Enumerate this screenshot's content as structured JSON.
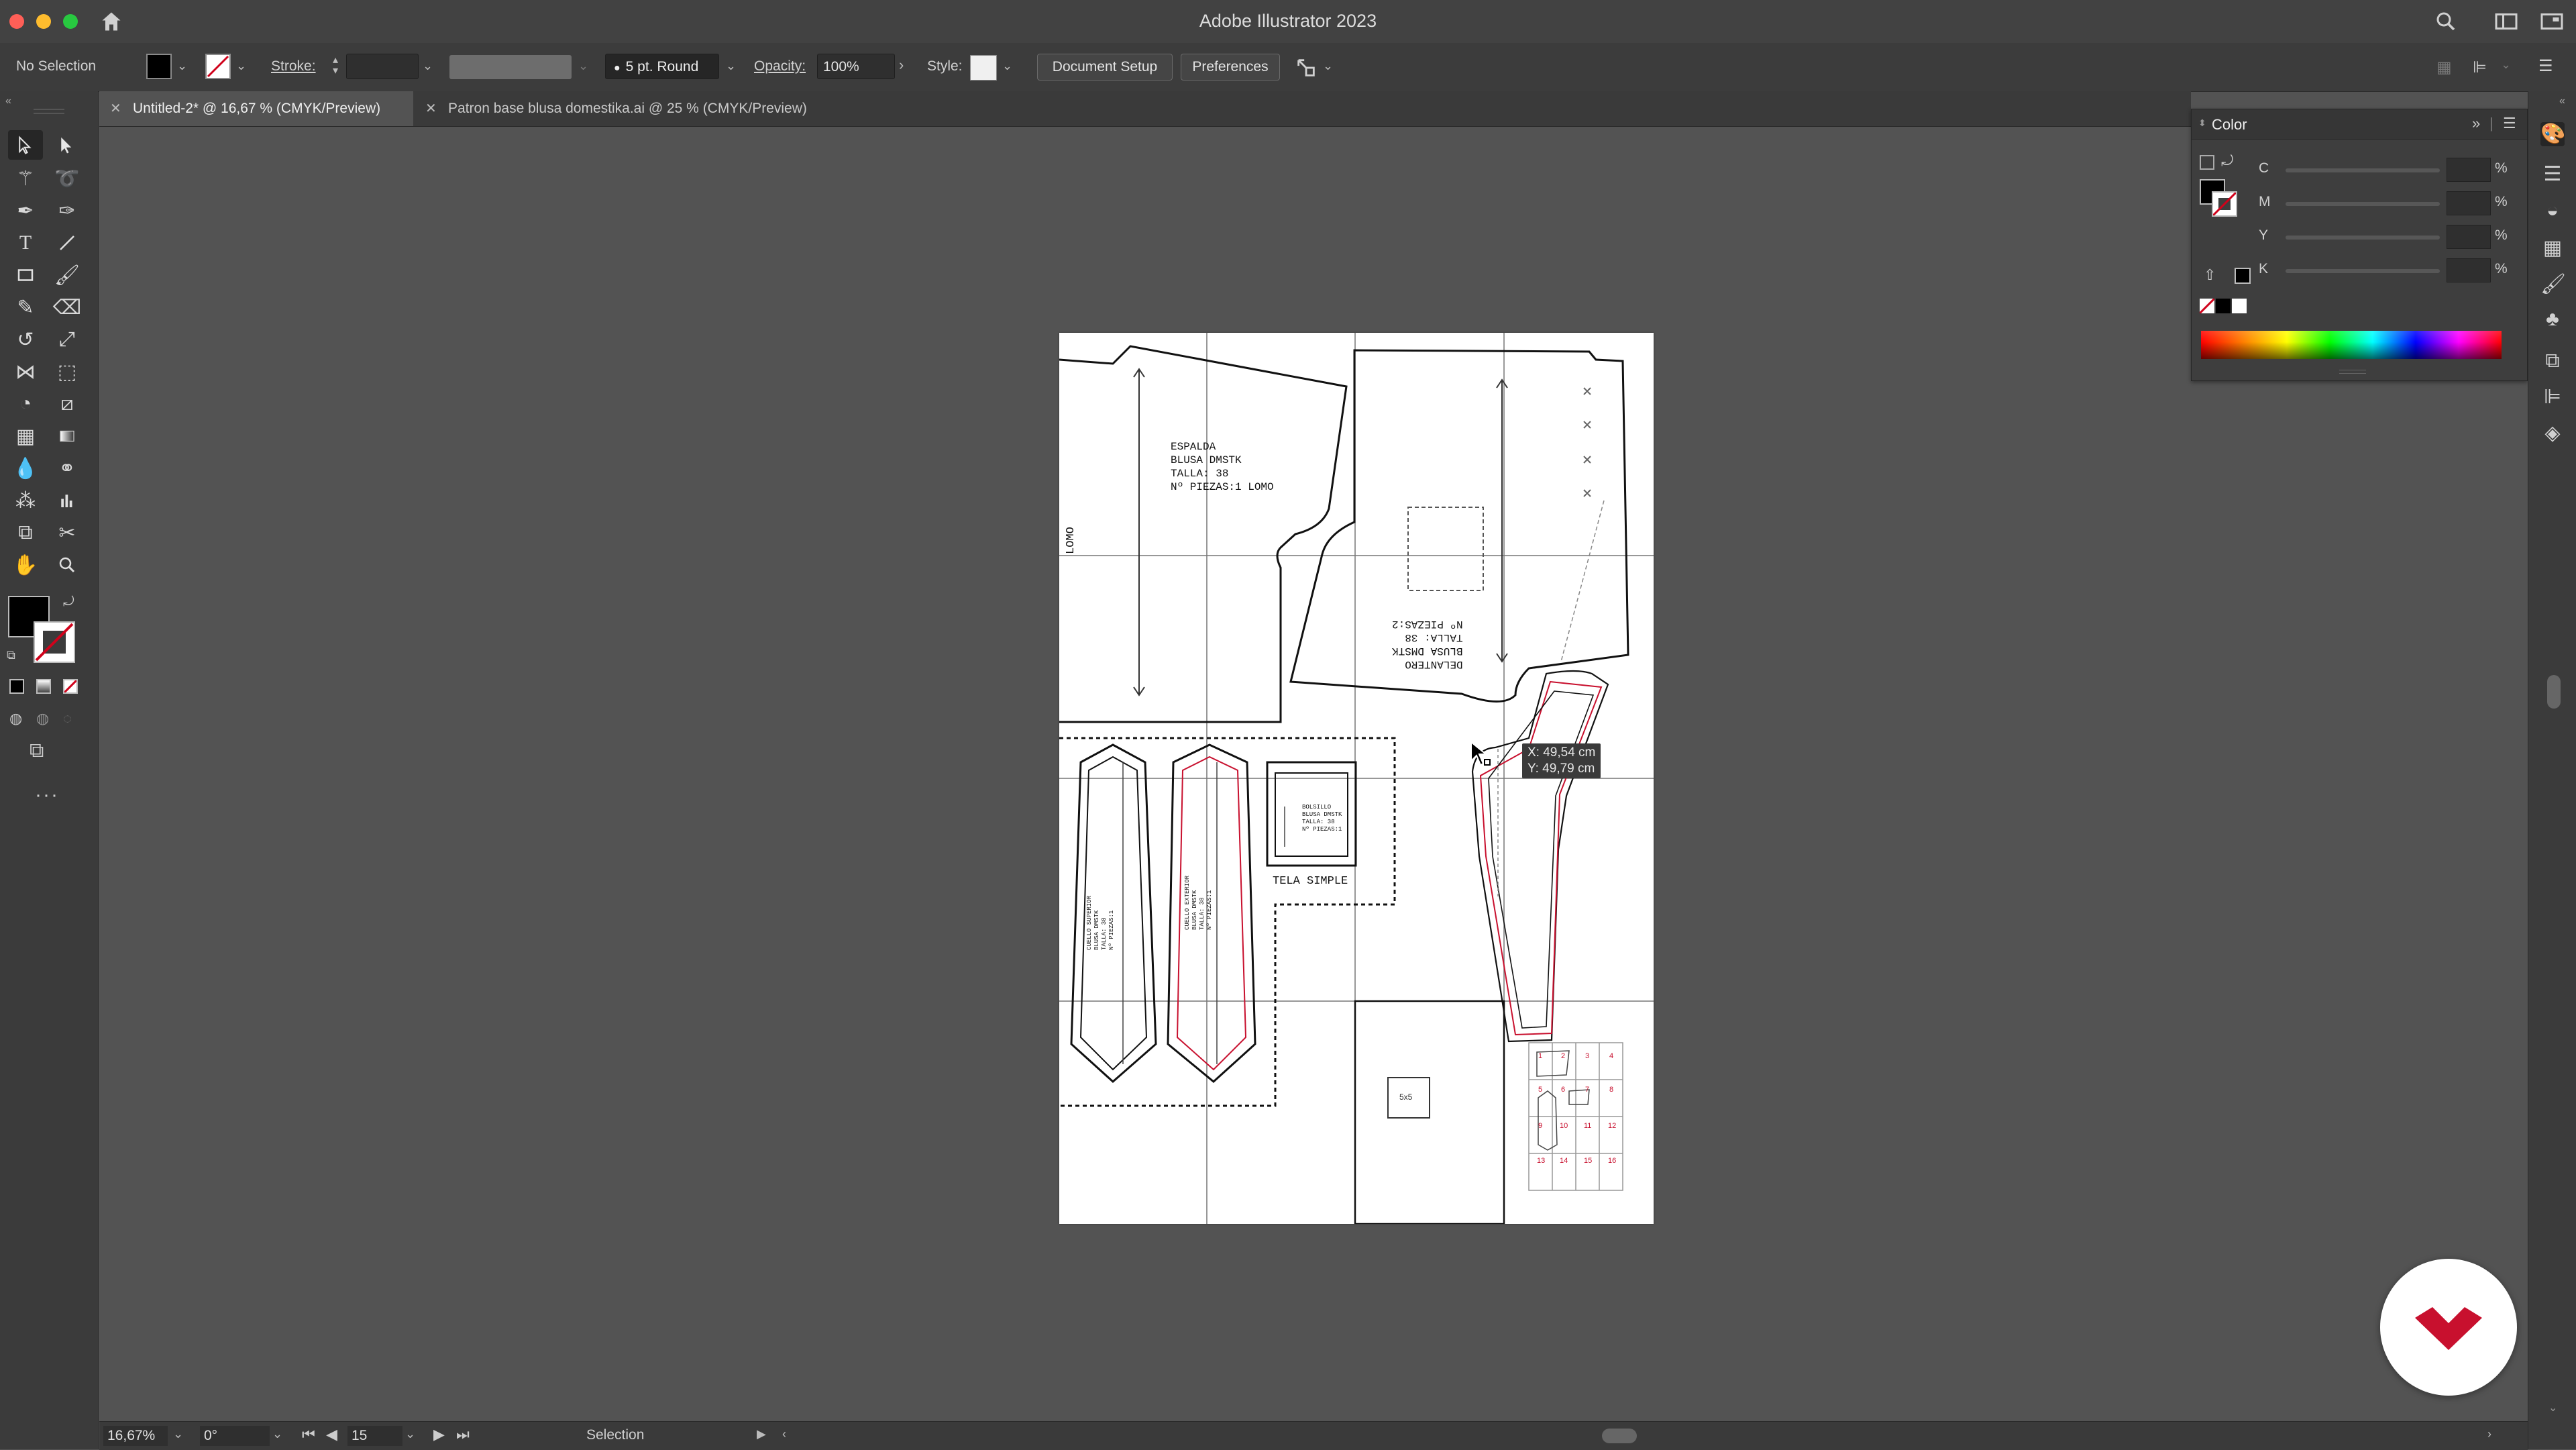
{
  "app": {
    "title": "Adobe Illustrator 2023"
  },
  "control_bar": {
    "selection_status": "No Selection",
    "stroke_label": "Stroke:",
    "brush_label": "5 pt. Round",
    "opacity_label": "Opacity:",
    "opacity_value": "100%",
    "style_label": "Style:",
    "document_setup": "Document Setup",
    "preferences": "Preferences"
  },
  "tabs": [
    {
      "label": "Untitled-2* @ 16,67 % (CMYK/Preview)",
      "active": true
    },
    {
      "label": "Patron base blusa domestika.ai @ 25 % (CMYK/Preview)",
      "active": false
    }
  ],
  "color_panel": {
    "title": "Color",
    "channels": [
      {
        "label": "C",
        "unit": "%"
      },
      {
        "label": "M",
        "unit": "%"
      },
      {
        "label": "Y",
        "unit": "%"
      },
      {
        "label": "K",
        "unit": "%"
      }
    ]
  },
  "canvas": {
    "espalda_text": [
      "ESPALDA",
      "BLUSA DMSTK",
      "TALLA: 38",
      "Nº PIEZAS:1 LOMO"
    ],
    "lomo_label": "LOMO",
    "delantero_text": [
      "DELANTERO",
      "BLUSA DMSTK",
      "TALLA: 38",
      "Nº PIEZAS:2"
    ],
    "cuello_sup_text": [
      "CUELLO SUPERIOR",
      "BLUSA DMSTK",
      "TALLA: 38",
      "Nº PIEZAS:1"
    ],
    "cuello_ext_text": [
      "CUELLO EXTERIOR",
      "BLUSA DMSTK",
      "TALLA: 38",
      "Nº PIEZAS:1"
    ],
    "bolsillo_text": [
      "BOLSILLO",
      "BLUSA DMSTK",
      "TALLA: 38",
      "Nº PIEZAS:1"
    ],
    "tela_simple": "TELA SIMPLE",
    "square_label": "5x5",
    "cursor_x": "X: 49,54 cm",
    "cursor_y": "Y: 49,79 cm",
    "tile_numbers": [
      "1",
      "2",
      "3",
      "4",
      "5",
      "6",
      "7",
      "8",
      "9",
      "10",
      "11",
      "12",
      "13",
      "14",
      "15",
      "16"
    ]
  },
  "status_bar": {
    "zoom": "16,67%",
    "rotation": "0°",
    "artboard": "15",
    "tool": "Selection"
  },
  "colors": {
    "accent_red": "#c8102e",
    "chrome_dark": "#3b3b3b",
    "canvas_bg": "#535353"
  }
}
